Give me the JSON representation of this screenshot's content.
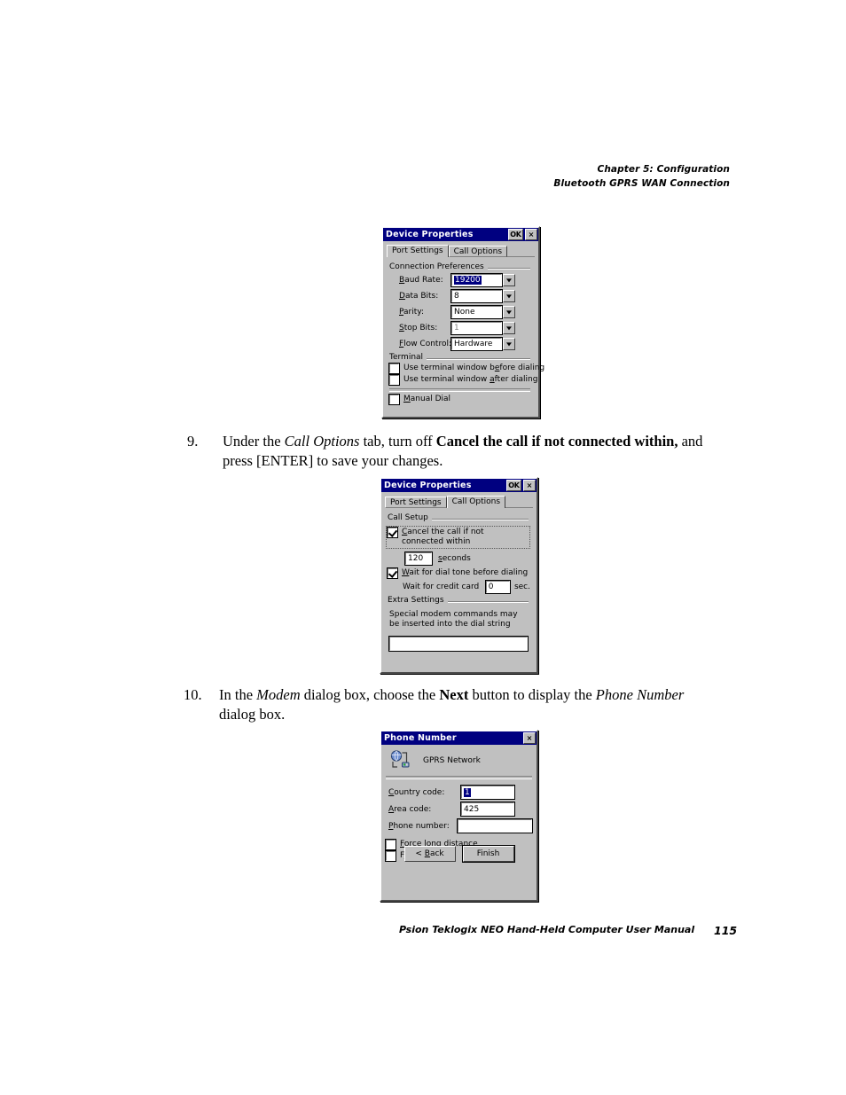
{
  "page": {
    "header_line1": "Chapter 5:  Configuration",
    "header_line2": "Bluetooth GPRS WAN Connection",
    "footer_title": "Psion Teklogix NEO Hand-Held Computer User Manual",
    "footer_page": "115"
  },
  "steps": [
    {
      "number": "9.",
      "text_parts": [
        {
          "t": "Under the ",
          "style": "normal"
        },
        {
          "t": "Call Options",
          "style": "italic"
        },
        {
          "t": " tab, turn off ",
          "style": "normal"
        },
        {
          "t": "Cancel the call if not connected within,",
          "style": "bold"
        },
        {
          "t": " and press [ENTER] to save your changes.",
          "style": "normal"
        }
      ]
    },
    {
      "number": "10.",
      "text_parts": [
        {
          "t": "In the ",
          "style": "normal"
        },
        {
          "t": "Modem",
          "style": "italic"
        },
        {
          "t": " dialog box, choose the ",
          "style": "normal"
        },
        {
          "t": "Next",
          "style": "bold"
        },
        {
          "t": " button to display the ",
          "style": "normal"
        },
        {
          "t": "Phone Number",
          "style": "italic"
        },
        {
          "t": " dialog box.",
          "style": "normal"
        }
      ]
    }
  ],
  "dialog_port_settings": {
    "title": "Device Properties",
    "ok_label": "OK",
    "close_label": "×",
    "tabs": [
      {
        "label": "Port Settings",
        "active": true
      },
      {
        "label": "Call Options",
        "active": false
      }
    ],
    "group_label": "Connection Preferences",
    "fields": [
      {
        "label": "Baud Rate:",
        "mnemonic": "B",
        "value": "19200",
        "selected": true,
        "disabled": false
      },
      {
        "label": "Data Bits:",
        "mnemonic": "D",
        "value": "8",
        "selected": false,
        "disabled": false
      },
      {
        "label": "Parity:",
        "mnemonic": "P",
        "value": "None",
        "selected": false,
        "disabled": false
      },
      {
        "label": "Stop Bits:",
        "mnemonic": "S",
        "value": "1",
        "selected": false,
        "disabled": true
      },
      {
        "label": "Flow Control:",
        "mnemonic": "F",
        "value": "Hardware",
        "selected": false,
        "disabled": false
      }
    ],
    "terminal_group_label": "Terminal",
    "checkboxes": [
      {
        "label": "Use terminal window before dialing",
        "checked": false
      },
      {
        "label": "Use terminal window after dialing",
        "checked": false
      },
      {
        "label": "Manual Dial",
        "checked": false
      }
    ]
  },
  "dialog_call_options": {
    "title": "Device Properties",
    "ok_label": "OK",
    "close_label": "×",
    "tabs": [
      {
        "label": "Port Settings",
        "active": false
      },
      {
        "label": "Call Options",
        "active": true
      }
    ],
    "call_setup_label": "Call Setup",
    "cancel_checkbox_label": "Cancel the call if not connected within",
    "cancel_checked": true,
    "seconds_value": "120",
    "seconds_label": "seconds",
    "wait_dialtone_label": "Wait for dial tone before dialing",
    "wait_dialtone_checked": true,
    "credit_card_label": "Wait for credit card",
    "credit_card_value": "0",
    "credit_card_unit": "sec.",
    "extra_settings_label": "Extra Settings",
    "extra_note": "Special modem commands may be inserted into the dial string",
    "extra_input_value": ""
  },
  "dialog_phone_number": {
    "title": "Phone Number",
    "close_label": "×",
    "connection_name": "GPRS Network",
    "icon": "network-connection-icon",
    "fields": [
      {
        "label": "Country code:",
        "value": "1",
        "selected": true
      },
      {
        "label": "Area code:",
        "value": "425",
        "selected": false
      },
      {
        "label": "Phone number:",
        "value": "",
        "selected": false
      }
    ],
    "checkboxes": [
      {
        "label": "Force long distance",
        "checked": false
      },
      {
        "label": "Force local",
        "checked": false
      }
    ],
    "buttons": [
      {
        "label": "< Back",
        "default": false
      },
      {
        "label": "Finish",
        "default": true
      }
    ]
  },
  "colors": {
    "titlebar": "#000080",
    "dialog_face": "#c0c0c0",
    "selection": "#000080",
    "field_bg": "#ffffff"
  }
}
